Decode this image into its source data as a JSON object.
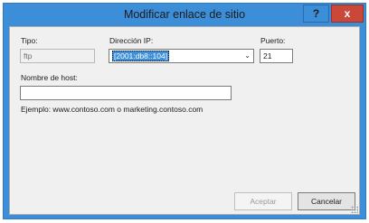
{
  "window": {
    "title": "Modificar enlace de sitio",
    "help_label": "?",
    "close_label": "x"
  },
  "form": {
    "type_label": "Tipo:",
    "type_value": "ftp",
    "ip_label": "Dirección IP:",
    "ip_value": "[2001:db8::104]",
    "port_label": "Puerto:",
    "port_value": "21",
    "host_label": "Nombre de host:",
    "host_value": "",
    "example_text": "Ejemplo: www.contoso.com o marketing.contoso.com"
  },
  "buttons": {
    "accept_label": "Aceptar",
    "cancel_label": "Cancelar"
  },
  "colors": {
    "titlebar": "#3c8ed8",
    "close_button": "#c9483a",
    "dialog_background": "#f0f0f0"
  },
  "icons": {
    "dropdown": "chevron-down-icon"
  }
}
